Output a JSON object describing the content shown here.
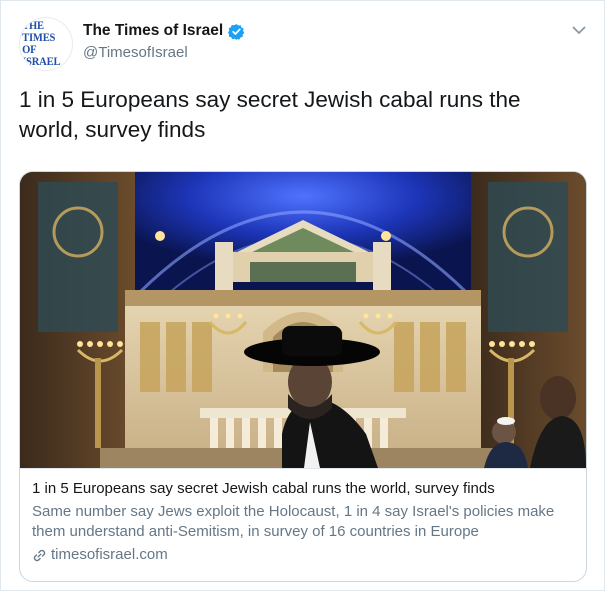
{
  "account": {
    "avatar_line1": "THE TIMES",
    "avatar_line2": "OF ISRAEL",
    "display_name": "The Times of Israel",
    "handle": "@TimesofIsrael"
  },
  "tweet": {
    "text": "1 in 5 Europeans say secret Jewish cabal runs the world, survey finds"
  },
  "card": {
    "title": "1 in 5 Europeans say secret Jewish cabal runs the world, survey finds",
    "description": "Same number say Jews exploit the Holocaust, 1 in 4 say Israel's policies make them understand anti-Semitism, in survey of 16 countries in Europe",
    "domain": "timesofisrael.com",
    "domain_icon": "link-icon",
    "image_subject": "synagogue-interior-photo"
  },
  "icons": {
    "verified": "verified-badge-icon",
    "menu": "chevron-down-icon"
  },
  "colors": {
    "brand_blue": "#1f4fa8",
    "verified_blue": "#1da1f2",
    "text_primary": "#14171a",
    "text_secondary": "#657786",
    "border": "#ccd6dd"
  }
}
